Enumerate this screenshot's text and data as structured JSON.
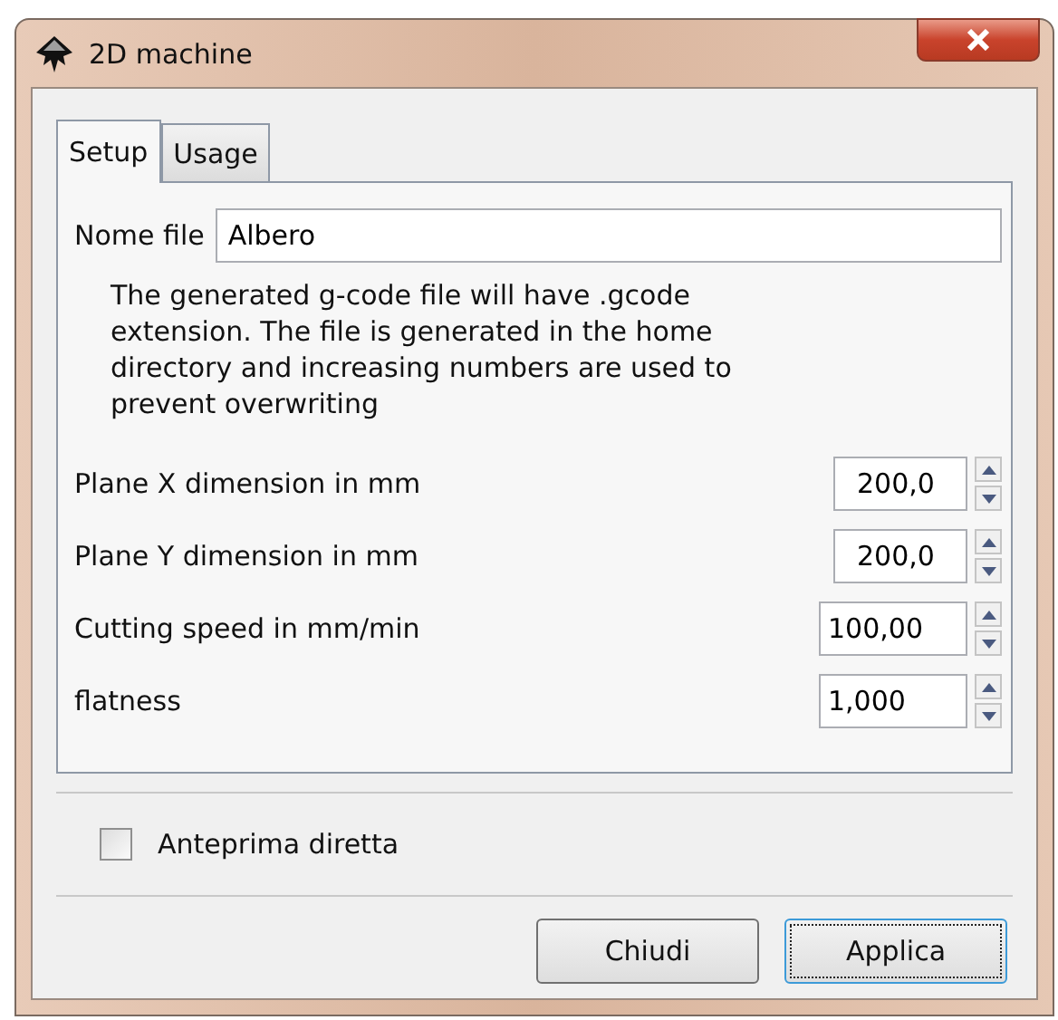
{
  "window": {
    "title": "2D machine"
  },
  "tabs": [
    {
      "label": "Setup",
      "selected": true
    },
    {
      "label": "Usage",
      "selected": false
    }
  ],
  "file_name": {
    "label": "Nome file",
    "value": "Albero"
  },
  "note": "The generated g-code file will have .gcode extension. The file is generated in the home directory and increasing numbers are used to prevent overwriting",
  "fields": [
    {
      "label": "Plane X dimension in mm",
      "value": "200,0"
    },
    {
      "label": "Plane Y dimension in mm",
      "value": "200,0"
    },
    {
      "label": "Cutting speed in mm/min",
      "value": "100,00"
    },
    {
      "label": "flatness",
      "value": "1,000"
    }
  ],
  "live_preview": {
    "label": "Anteprima diretta",
    "checked": false
  },
  "buttons": [
    {
      "label": "Chiudi",
      "focused": false
    },
    {
      "label": "Applica",
      "focused": true
    }
  ]
}
